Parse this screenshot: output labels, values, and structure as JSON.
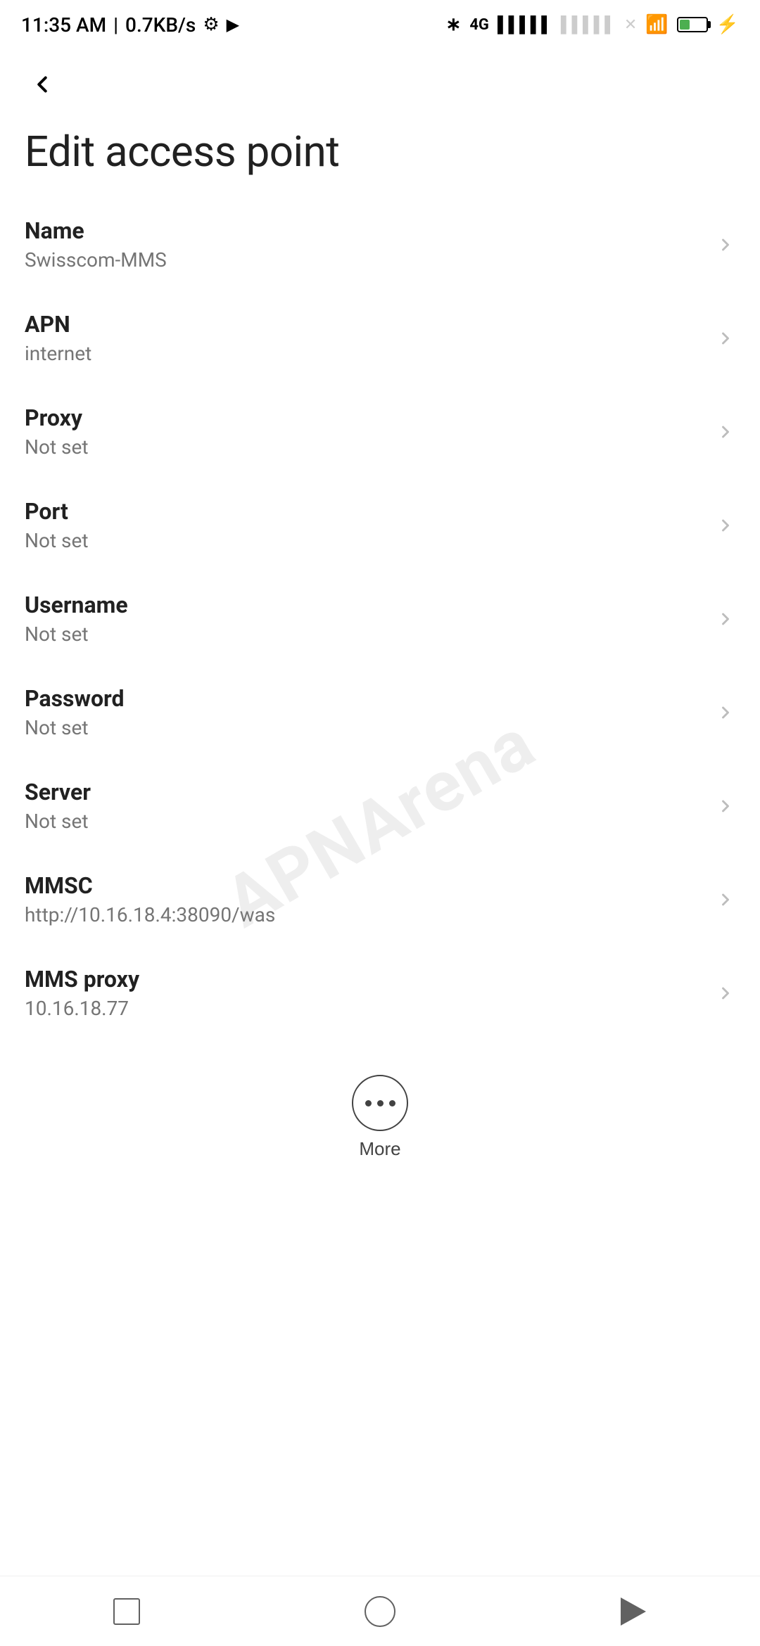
{
  "statusBar": {
    "time": "11:35 AM",
    "speed": "0.7KB/s"
  },
  "pageTitle": "Edit access point",
  "backButton": "back",
  "settings": [
    {
      "label": "Name",
      "value": "Swisscom-MMS"
    },
    {
      "label": "APN",
      "value": "internet"
    },
    {
      "label": "Proxy",
      "value": "Not set"
    },
    {
      "label": "Port",
      "value": "Not set"
    },
    {
      "label": "Username",
      "value": "Not set"
    },
    {
      "label": "Password",
      "value": "Not set"
    },
    {
      "label": "Server",
      "value": "Not set"
    },
    {
      "label": "MMSC",
      "value": "http://10.16.18.4:38090/was"
    },
    {
      "label": "MMS proxy",
      "value": "10.16.18.77"
    }
  ],
  "moreButton": {
    "label": "More"
  },
  "watermark": "APNArena"
}
